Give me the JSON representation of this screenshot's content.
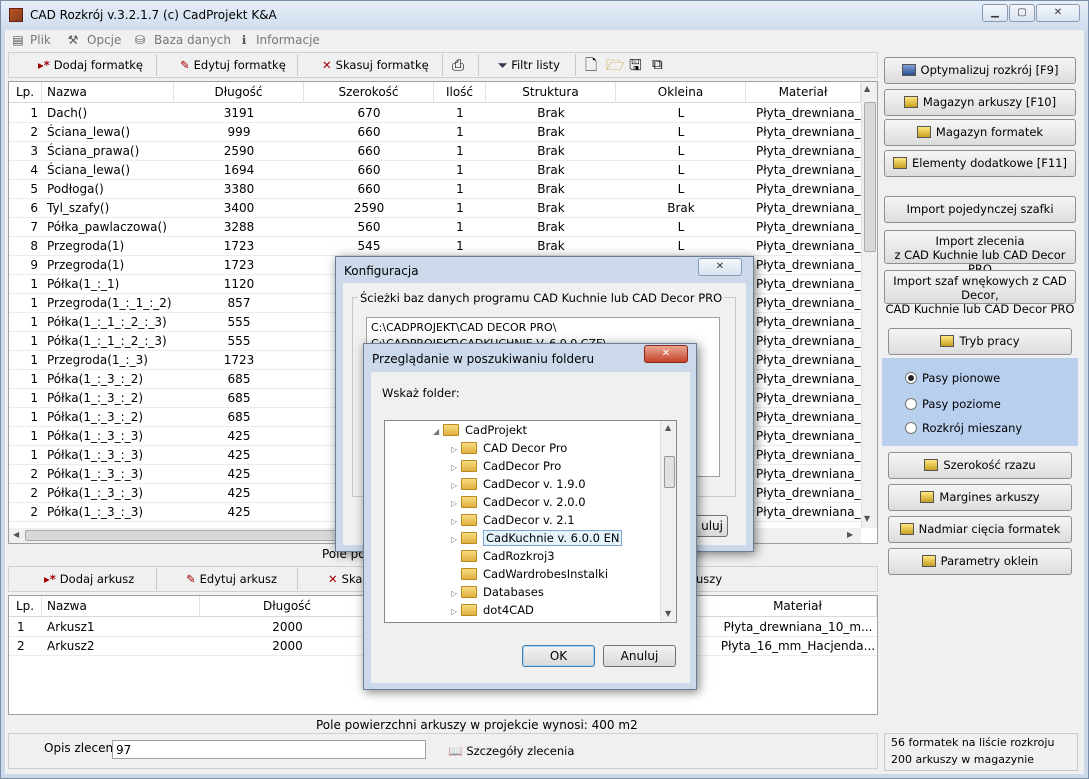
{
  "window": {
    "title": "CAD Rozkrój v.3.2.1.7  (c) CadProjekt K&A"
  },
  "menu": {
    "items": [
      "Plik",
      "Opcje",
      "Baza danych",
      "Informacje"
    ]
  },
  "toolbar_top": {
    "add": "Dodaj formatkę",
    "edit": "Edytuj formatkę",
    "delete": "Skasuj formatkę",
    "filter": "Filtr listy"
  },
  "formats_table": {
    "columns": [
      "Lp.",
      "Nazwa",
      "Długość",
      "Szerokość",
      "Ilość",
      "Struktura",
      "Okleina",
      "Materiał"
    ],
    "rows": [
      [
        "1",
        "Dach()",
        "3191",
        "670",
        "1",
        "Brak",
        "L",
        "Płyta_drewniana_1"
      ],
      [
        "2",
        "Ściana_lewa()",
        "999",
        "660",
        "1",
        "Brak",
        "L",
        "Płyta_drewniana_1"
      ],
      [
        "3",
        "Ściana_prawa()",
        "2590",
        "660",
        "1",
        "Brak",
        "L",
        "Płyta_drewniana_1"
      ],
      [
        "4",
        "Ściana_lewa()",
        "1694",
        "660",
        "1",
        "Brak",
        "L",
        "Płyta_drewniana_1"
      ],
      [
        "5",
        "Podłoga()",
        "3380",
        "660",
        "1",
        "Brak",
        "L",
        "Płyta_drewniana_1"
      ],
      [
        "6",
        "Tyl_szafy()",
        "3400",
        "2590",
        "1",
        "Brak",
        "Brak",
        "Płyta_drewniana_1"
      ],
      [
        "7",
        "Półka_pawlaczowa()",
        "3288",
        "560",
        "1",
        "Brak",
        "L",
        "Płyta_drewniana_1"
      ],
      [
        "8",
        "Przegroda(1)",
        "1723",
        "545",
        "1",
        "Brak",
        "L",
        "Płyta_drewniana_1"
      ],
      [
        "9",
        "Przegroda(1)",
        "1723",
        "",
        "",
        "",
        "",
        "Płyta_drewniana_1"
      ],
      [
        "1",
        "Półka(1_:_1)",
        "1120",
        "",
        "",
        "",
        "",
        "Płyta_drewniana_1"
      ],
      [
        "1",
        "Przegroda(1_:_1_:_2)",
        "857",
        "",
        "",
        "",
        "",
        "Płyta_drewniana_1"
      ],
      [
        "1",
        "Półka(1_:_1_:_2_:_3)",
        "555",
        "",
        "",
        "",
        "",
        "Płyta_drewniana_1"
      ],
      [
        "1",
        "Półka(1_:_1_:_2_:_3)",
        "555",
        "",
        "",
        "",
        "",
        "Płyta_drewniana_1"
      ],
      [
        "1",
        "Przegroda(1_:_3)",
        "1723",
        "",
        "",
        "",
        "",
        "Płyta_drewniana_1"
      ],
      [
        "1",
        "Półka(1_:_3_:_2)",
        "685",
        "",
        "",
        "",
        "",
        "Płyta_drewniana_1"
      ],
      [
        "1",
        "Półka(1_:_3_:_2)",
        "685",
        "",
        "",
        "",
        "",
        "Płyta_drewniana_1"
      ],
      [
        "1",
        "Półka(1_:_3_:_2)",
        "685",
        "",
        "",
        "",
        "",
        "Płyta_drewniana_1"
      ],
      [
        "1",
        "Półka(1_:_3_:_3)",
        "425",
        "",
        "",
        "",
        "",
        "Płyta_drewniana_1"
      ],
      [
        "1",
        "Półka(1_:_3_:_3)",
        "425",
        "",
        "",
        "",
        "",
        "Płyta_drewniana_1"
      ],
      [
        "2",
        "Półka(1_:_3_:_3)",
        "425",
        "",
        "",
        "",
        "",
        "Płyta_drewniana_1"
      ],
      [
        "2",
        "Półka(1_:_3_:_3)",
        "425",
        "",
        "",
        "",
        "",
        "Płyta_drewniana_1"
      ],
      [
        "2",
        "Półka(1_:_3_:_3)",
        "425",
        "",
        "",
        "",
        "",
        "Płyta_drewniana_1"
      ]
    ]
  },
  "formats_footer": "Pole pov",
  "toolbar_bottom": {
    "add": "Dodaj arkusz",
    "edit": "Edytuj arkusz",
    "delete": "Ska",
    "extra": "uszy"
  },
  "sheets_table": {
    "columns": [
      "Lp.",
      "Nazwa",
      "Długość",
      "Materiał"
    ],
    "rows": [
      [
        "1",
        "Arkusz1",
        "2000",
        "Płyta_drewniana_10_m..."
      ],
      [
        "2",
        "Arkusz2",
        "2000",
        "Płyta_16_mm_Hacjenda..."
      ]
    ]
  },
  "sheets_footer": "Pole powierzchni arkuszy w projekcie wynosi: 400 m2",
  "order": {
    "label": "Opis zlecenia",
    "value": "97",
    "details": "Szczegóły zlecenia"
  },
  "right_panel": {
    "optimize": "Optymalizuj rozkrój [F9]",
    "sheets_store": "Magazyn arkuszy [F10]",
    "formats_store": "Magazyn formatek",
    "extra_elements": "Elementy dodatkowe [F11]",
    "import_single": "Import pojedynczej szafki",
    "import_order_l1": "Import zlecenia",
    "import_order_l2": "z CAD Kuchnie lub CAD Decor PRO",
    "import_corner_l1": "Import szaf wnękowych z CAD Decor,",
    "import_corner_l2": "CAD Kuchnie lub CAD Decor PRO",
    "mode": "Tryb pracy",
    "radio": [
      "Pasy pionowe",
      "Pasy poziome",
      "Rozkrój mieszany"
    ],
    "strip_width": "Szerokość rzazu",
    "sheet_margin": "Margines arkuszy",
    "format_cut_excess": "Nadmiar cięcia formatek",
    "veneer_params": "Parametry oklein"
  },
  "status": {
    "formats": "56 formatek na liście rozkroju",
    "sheets": "200 arkuszy w magazynie"
  },
  "config_dialog": {
    "title": "Konfiguracja",
    "group": "Ścieżki baz danych programu CAD Kuchnie lub CAD Decor PRO",
    "paths": [
      "C:\\CADPROJEKT\\CAD DECOR PRO\\",
      "C:\\CADPROJEKT\\CADKUCHNIE V. 6.0.0 CZE\\"
    ],
    "cancel_partial": "uluj"
  },
  "folder_dialog": {
    "title": "Przeglądanie w poszukiwaniu folderu",
    "prompt": "Wskaż folder:",
    "parent": "CadProjekt",
    "items": [
      "CAD Decor Pro",
      "CadDecor Pro",
      "CadDecor v. 1.9.0",
      "CadDecor v. 2.0.0",
      "CadDecor v. 2.1",
      "CadKuchnie v. 6.0.0 EN",
      "CadRozkroj3",
      "CadWardrobesInstalki",
      "Databases",
      "dot4CAD"
    ],
    "selected": "CadKuchnie v. 6.0.0 EN",
    "ok": "OK",
    "cancel": "Anuluj"
  }
}
